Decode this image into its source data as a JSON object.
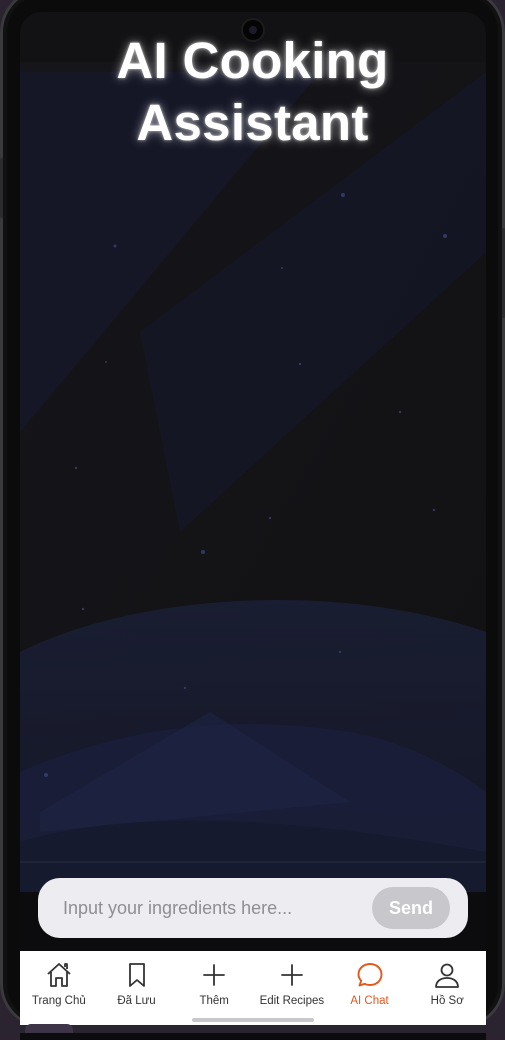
{
  "app": {
    "title": "AI Cooking Assistant"
  },
  "chat_input": {
    "placeholder": "Input your ingredients here...",
    "value": "",
    "send_label": "Send"
  },
  "tabs": [
    {
      "label": "Trang Chủ",
      "icon": "home-icon",
      "active": false
    },
    {
      "label": "Đã Lưu",
      "icon": "bookmark-icon",
      "active": false
    },
    {
      "label": "Thêm",
      "icon": "plus-icon",
      "active": false
    },
    {
      "label": "Edit Recipes",
      "icon": "plus-icon",
      "active": false
    },
    {
      "label": "AI Chat",
      "icon": "chat-bubble-icon",
      "active": true
    },
    {
      "label": "Hồ Sơ",
      "icon": "person-icon",
      "active": false
    }
  ],
  "colors": {
    "accent": "#e8561a",
    "background": "#121214",
    "input_bg": "#ececf1",
    "send_disabled": "#c7c7cc"
  }
}
